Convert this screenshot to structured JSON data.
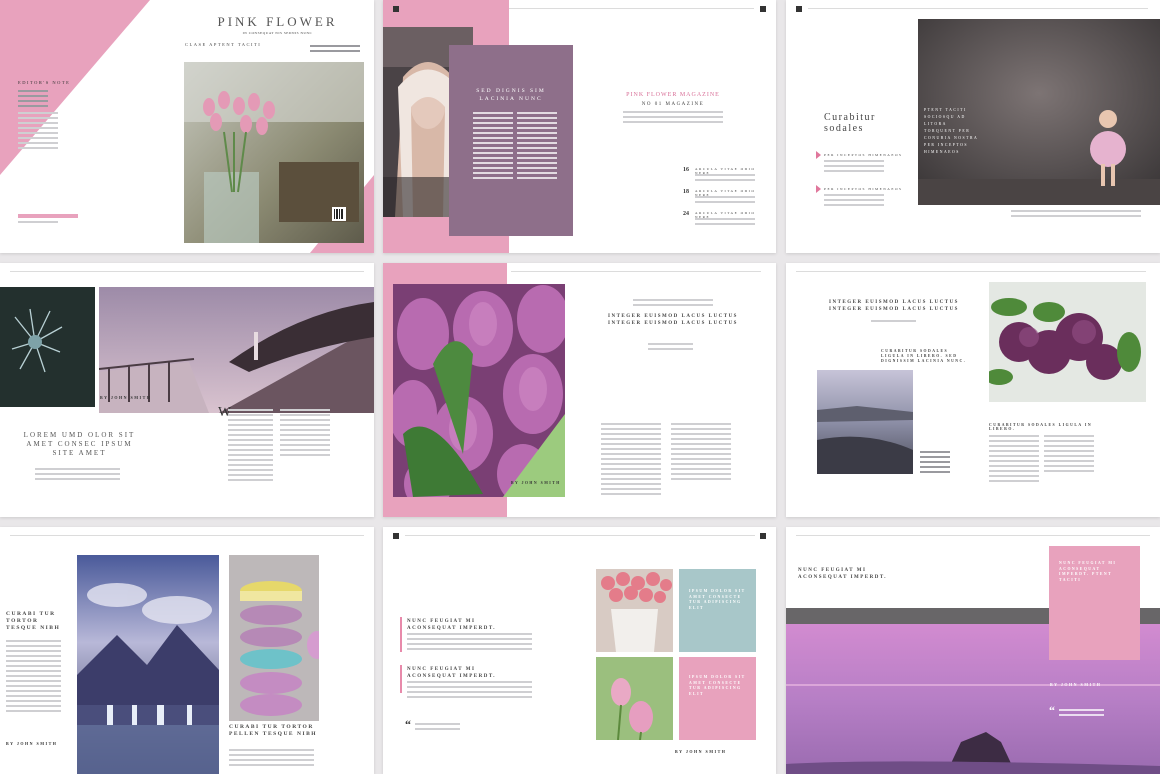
{
  "colors": {
    "pink": "#e8a2bd",
    "mauve": "#8e6f8a",
    "green": "#9ccb7e",
    "teal": "#a8c7c9",
    "text_dark": "#444444",
    "background": "#e9e7e9"
  },
  "cover": {
    "title": "PINK FLOWER",
    "subtitle": "IN CONSEQUAT NIS SEDNIS NUNC",
    "tagline": "CLASE APTENT TACITI",
    "side_label": "EDITOR'S NOTE"
  },
  "spread2": {
    "panel_heading": "SED DIGNIS SIM LACINIA NUNC",
    "magazine_title": "PINK FLOWER MAGAZINE",
    "magazine_sub": "NO 01 MAGAZINE",
    "numbers": [
      "16",
      "18",
      "24"
    ],
    "items": [
      "ARCULA VITAE ODIO NERE",
      "ARCULA VITAE ODIO NERE",
      "ARCULA VITAE ODIO NERE"
    ]
  },
  "spread3": {
    "heading": "Curabitur sodales",
    "items": [
      "PER INCEPTOS HIMENAEOS",
      "PER INCEPTOS HIMENAEOS"
    ],
    "caption": "PTENT TACITI SOCIOSQU AD LITORA TORQUENT PER CONUBIA NOSTRA PER INCEPTOS HIMENAEOS"
  },
  "spread4": {
    "heading": "LOREM UMD OLOR SIT AMET CONSEC IPSUM SITE AMET",
    "byline": "BY JOHN SMITH",
    "dropcap": "W"
  },
  "spread5": {
    "heading": "INTEGER EUISMOD LACUS LUCTUS INTEGER EUISMOD LACUS LUCTUS",
    "byline": "BY JOHN SMITH"
  },
  "spread6": {
    "heading": "INTEGER EUISMOD LACUS LUCTUS INTEGER EUISMOD LACUS LUCTUS",
    "subheading": "CURABITUR SODALES LIGULA IN LIBERO. SED DIGNISSIM LACINIA NUNC.",
    "subheading2": "CURABITUR SODALES LIGULA IN LIBERO."
  },
  "spread7": {
    "heading_left": "CURABI TUR TORTOR TESQUE NIBH",
    "heading_right": "CURABI TUR TORTOR PELLEN TESQUE NIBH",
    "byline": "BY JOHN SMITH"
  },
  "spread8": {
    "heading1": "NUNC FEUGIAT MI ACONSEQUAT IMPERDT.",
    "heading2": "NUNC FEUGIAT MI ACONSEQUAT IMPERDT.",
    "box_teal": "IPSUM DOLOR SIT AMET CONSECTE TUR ADIPISCING ELIT",
    "box_pink": "IPSUM DOLOR SIT AMET CONSECTE TUR ADIPISCING ELIT",
    "byline": "BY JOHN SMITH"
  },
  "spread9": {
    "heading": "NUNC FEUGIAT MI ACONSEQUAT IMPERDT.",
    "byline": "BY JOHN SMITH",
    "box_text": "NUNC FEUGIAT MI ACONSEQUAT IMPERDT. PTENT TACITI"
  }
}
